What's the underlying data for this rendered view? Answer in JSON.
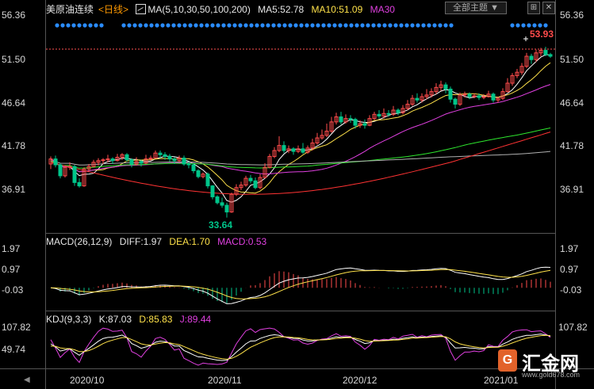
{
  "header": {
    "title": "美原油连续",
    "period": "<日线>",
    "ma_setting": "MA(5,10,30,50,100,200)",
    "ma5": "MA5:52.78",
    "ma10": "MA10:51.09",
    "ma30": "MA30",
    "theme_button": "全部主题",
    "theme_arrow": "▼",
    "btn1": "⊞",
    "btn2": "✕"
  },
  "macd_header": {
    "name": "MACD(26,12,9)",
    "diff": "DIFF:1.97",
    "dea": "DEA:1.70",
    "macd": "MACD:0.53"
  },
  "kdj_header": {
    "name": "KDJ(9,3,3)",
    "k": "K:87.03",
    "d": "D:85.83",
    "j": "J:89.44"
  },
  "logo": {
    "text": "汇金网",
    "url": "www.gold678.com",
    "mark": "G"
  },
  "nav_arrow": "◀",
  "colors": {
    "up": "#ff4b4b",
    "down": "#00c58a",
    "ma5": "#ffffff",
    "ma10": "#ffe24a",
    "ma30": "#e040e0",
    "ma50": "#2ee62e",
    "ma100": "#b0b0b0",
    "ma200": "#ff3333",
    "dots": "#2a8cff"
  },
  "chart_data": {
    "type": "candlestick",
    "x_ticks": [
      "2020/10",
      "2020/11",
      "2020/12",
      "2021/01"
    ],
    "y_ticks_price": [
      "56.36",
      "51.50",
      "46.64",
      "41.78",
      "36.91"
    ],
    "y_ticks_macd": [
      "1.97",
      "0.97",
      "-0.03"
    ],
    "y_ticks_kdj": [
      "107.82",
      "49.74"
    ],
    "price_ylim": [
      32.0,
      57.6
    ],
    "current_price": "53.93",
    "low_annotation": "33.64",
    "candles": [
      [
        40.0,
        40.6,
        39.4,
        40.9
      ],
      [
        40.6,
        39.9,
        39.6,
        41.0
      ],
      [
        39.9,
        38.6,
        38.3,
        40.1
      ],
      [
        38.6,
        39.6,
        38.4,
        39.8
      ],
      [
        39.6,
        39.7,
        39.3,
        40.2
      ],
      [
        39.7,
        37.8,
        37.4,
        39.9
      ],
      [
        37.8,
        37.4,
        37.2,
        38.3
      ],
      [
        37.4,
        39.4,
        37.3,
        39.6
      ],
      [
        39.4,
        39.7,
        39.1,
        40.0
      ],
      [
        39.7,
        40.2,
        39.6,
        40.5
      ],
      [
        40.2,
        40.4,
        39.8,
        40.7
      ],
      [
        40.4,
        40.5,
        40.0,
        40.7
      ],
      [
        40.5,
        40.6,
        40.2,
        41.1
      ],
      [
        40.6,
        40.4,
        40.0,
        40.8
      ],
      [
        40.4,
        40.8,
        40.3,
        41.2
      ],
      [
        40.8,
        41.1,
        40.5,
        41.3
      ],
      [
        41.1,
        40.5,
        40.3,
        41.3
      ],
      [
        40.5,
        40.0,
        39.6,
        40.7
      ],
      [
        40.0,
        40.3,
        39.8,
        40.8
      ],
      [
        40.3,
        40.1,
        39.7,
        40.5
      ],
      [
        40.1,
        40.6,
        40.0,
        41.1
      ],
      [
        40.6,
        40.7,
        40.4,
        41.0
      ],
      [
        40.7,
        41.3,
        40.7,
        41.6
      ],
      [
        41.3,
        41.1,
        40.7,
        41.6
      ],
      [
        41.1,
        40.9,
        40.5,
        41.4
      ],
      [
        40.9,
        40.6,
        40.3,
        41.2
      ],
      [
        40.6,
        40.4,
        40.0,
        40.8
      ],
      [
        40.4,
        40.7,
        40.2,
        41.0
      ],
      [
        40.7,
        40.0,
        39.8,
        41.0
      ],
      [
        40.0,
        39.9,
        39.5,
        40.3
      ],
      [
        39.9,
        39.2,
        38.9,
        40.1
      ],
      [
        39.2,
        38.5,
        38.3,
        39.4
      ],
      [
        38.5,
        38.8,
        38.3,
        39.0
      ],
      [
        38.8,
        37.4,
        37.1,
        39.0
      ],
      [
        37.4,
        36.1,
        35.8,
        37.5
      ],
      [
        36.1,
        35.4,
        35.2,
        36.3
      ],
      [
        35.4,
        35.1,
        34.8,
        36.0
      ],
      [
        35.1,
        34.3,
        33.64,
        35.4
      ],
      [
        34.3,
        36.4,
        34.2,
        36.6
      ],
      [
        36.4,
        37.2,
        36.2,
        37.6
      ],
      [
        37.2,
        37.5,
        36.9,
        37.9
      ],
      [
        37.5,
        38.3,
        37.3,
        38.6
      ],
      [
        38.3,
        38.0,
        37.7,
        38.7
      ],
      [
        38.0,
        37.2,
        37.0,
        38.4
      ],
      [
        37.2,
        38.4,
        37.0,
        38.8
      ],
      [
        38.4,
        39.6,
        38.3,
        40.1
      ],
      [
        39.6,
        40.9,
        39.5,
        41.2
      ],
      [
        40.9,
        41.6,
        40.7,
        42.0
      ],
      [
        41.6,
        42.2,
        41.4,
        43.3
      ],
      [
        42.2,
        41.6,
        41.3,
        42.7
      ],
      [
        41.6,
        41.8,
        41.3,
        42.2
      ],
      [
        41.8,
        41.5,
        41.1,
        42.0
      ],
      [
        41.5,
        41.8,
        41.3,
        42.2
      ],
      [
        41.8,
        41.4,
        41.2,
        42.5
      ],
      [
        41.4,
        41.9,
        41.2,
        42.2
      ],
      [
        41.9,
        42.5,
        41.6,
        43.0
      ],
      [
        42.5,
        43.1,
        42.3,
        43.7
      ],
      [
        43.1,
        43.4,
        42.9,
        44.1
      ],
      [
        43.4,
        43.9,
        43.2,
        44.8
      ],
      [
        43.9,
        45.0,
        43.7,
        45.6
      ],
      [
        45.0,
        45.6,
        44.7,
        46.1
      ],
      [
        45.6,
        45.0,
        44.7,
        46.2
      ],
      [
        45.0,
        45.4,
        44.8,
        45.9
      ],
      [
        45.4,
        45.3,
        44.9,
        45.8
      ],
      [
        45.3,
        44.6,
        44.2,
        45.5
      ],
      [
        44.6,
        44.8,
        44.3,
        45.2
      ],
      [
        44.8,
        44.6,
        44.2,
        45.3
      ],
      [
        44.6,
        45.4,
        44.5,
        45.8
      ],
      [
        45.4,
        45.9,
        45.2,
        46.2
      ],
      [
        45.9,
        45.7,
        45.4,
        46.4
      ],
      [
        45.7,
        46.0,
        45.4,
        46.6
      ],
      [
        46.0,
        45.9,
        45.6,
        46.4
      ],
      [
        45.9,
        46.4,
        45.7,
        46.9
      ],
      [
        46.4,
        46.1,
        45.8,
        46.6
      ],
      [
        46.1,
        46.6,
        45.9,
        47.0
      ],
      [
        46.6,
        47.1,
        46.4,
        47.6
      ],
      [
        47.1,
        47.8,
        46.9,
        48.2
      ],
      [
        47.8,
        47.6,
        47.3,
        48.4
      ],
      [
        47.6,
        48.0,
        47.3,
        48.4
      ],
      [
        48.0,
        48.2,
        47.7,
        48.9
      ],
      [
        48.2,
        48.6,
        47.9,
        49.0
      ],
      [
        48.6,
        49.1,
        48.3,
        49.6
      ],
      [
        49.1,
        49.4,
        48.7,
        49.9
      ],
      [
        49.4,
        48.9,
        48.4,
        49.7
      ],
      [
        48.9,
        47.7,
        47.3,
        49.2
      ],
      [
        47.7,
        47.1,
        46.6,
        47.9
      ],
      [
        47.1,
        48.2,
        46.9,
        48.5
      ],
      [
        48.2,
        48.3,
        47.9,
        48.6
      ],
      [
        48.3,
        48.0,
        47.7,
        48.5
      ],
      [
        48.0,
        48.1,
        47.8,
        48.4
      ],
      [
        48.1,
        47.9,
        47.6,
        48.4
      ],
      [
        47.9,
        48.0,
        47.7,
        48.3
      ],
      [
        48.0,
        48.3,
        47.9,
        48.7
      ],
      [
        48.3,
        47.6,
        47.3,
        48.5
      ],
      [
        47.6,
        47.8,
        47.3,
        48.0
      ],
      [
        47.8,
        48.6,
        47.6,
        49.0
      ],
      [
        48.6,
        49.6,
        48.5,
        50.2
      ],
      [
        49.6,
        50.5,
        49.3,
        50.8
      ],
      [
        50.5,
        50.9,
        50.2,
        51.3
      ],
      [
        50.9,
        51.6,
        50.6,
        52.0
      ],
      [
        51.6,
        52.8,
        51.4,
        53.2
      ],
      [
        52.8,
        52.4,
        51.9,
        53.1
      ],
      [
        52.4,
        53.2,
        52.1,
        53.6
      ],
      [
        53.2,
        53.5,
        52.8,
        53.8
      ],
      [
        53.5,
        53.0,
        52.8,
        53.93
      ],
      [
        53.0,
        52.8,
        52.6,
        53.2
      ]
    ]
  }
}
